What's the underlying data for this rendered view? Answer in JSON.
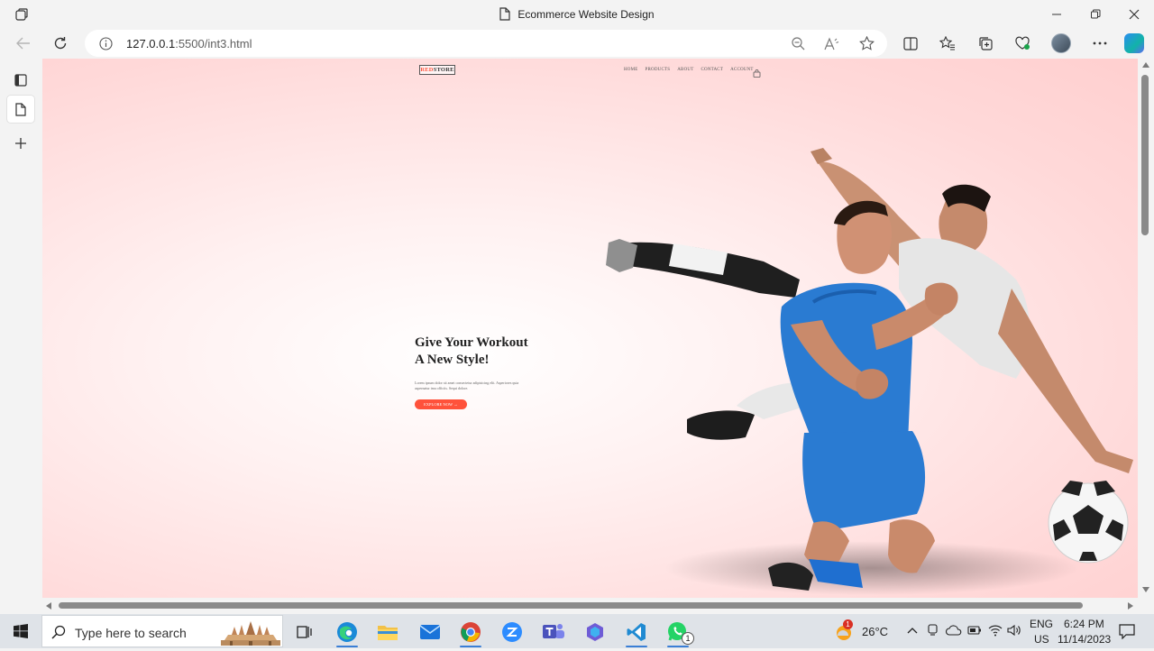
{
  "window": {
    "title": "Ecommerce Website Design"
  },
  "addressbar": {
    "url_host": "127.0.0.1",
    "url_rest": ":5500/int3.html"
  },
  "site": {
    "logo_red": "RED",
    "logo_dark": "STORE",
    "menu": [
      "HOME",
      "PRODUCTS",
      "ABOUT",
      "CONTACT",
      "ACCOUNT"
    ],
    "hero_title_line1": "Give Your Workout",
    "hero_title_line2": "A New Style!",
    "hero_text": "Lorem ipsum dolor sit amet consectetur adipisicing elit. Asperiores quia aspernatur ima officiis. Sequi dolore.",
    "cta_label": "EXPLORE NOW →",
    "accent_color": "#ff523b"
  },
  "taskbar": {
    "search_placeholder": "Type here to search",
    "weather_temp": "26°C",
    "weather_badge": "1",
    "whatsapp_badge": "1",
    "lang_top": "ENG",
    "lang_bottom": "US",
    "time": "6:24 PM",
    "date": "11/14/2023"
  }
}
